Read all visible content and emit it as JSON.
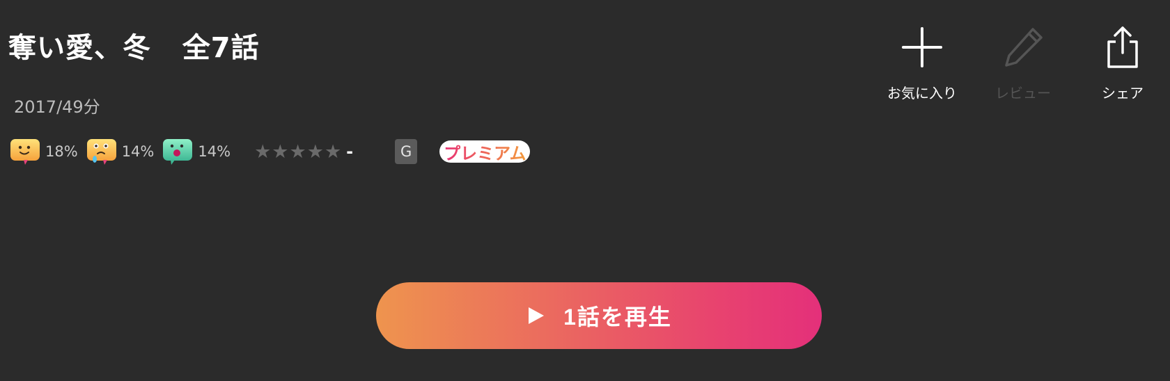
{
  "title": {
    "name": "奪い愛、冬",
    "episodes": "全7話"
  },
  "meta": "2017/49分",
  "reactions": [
    {
      "icon": "smile-emoji-icon",
      "percent": "18%"
    },
    {
      "icon": "crying-emoji-icon",
      "percent": "14%"
    },
    {
      "icon": "scared-emoji-icon",
      "percent": "14%"
    }
  ],
  "rating": {
    "stars_filled": 0,
    "stars_total": 5,
    "value": "-"
  },
  "age_rating": "G",
  "premium_label": "プレミアム",
  "actions": {
    "favorite": {
      "label": "お気に入り",
      "icon": "plus-icon"
    },
    "review": {
      "label": "レビュー",
      "icon": "pencil-icon",
      "disabled": true
    },
    "share": {
      "label": "シェア",
      "icon": "share-icon"
    }
  },
  "play_button": {
    "label": "1話を再生",
    "icon": "play-icon"
  },
  "colors": {
    "background": "#2b2b2b",
    "gradient_start": "#ee944e",
    "gradient_end": "#e4307a"
  }
}
